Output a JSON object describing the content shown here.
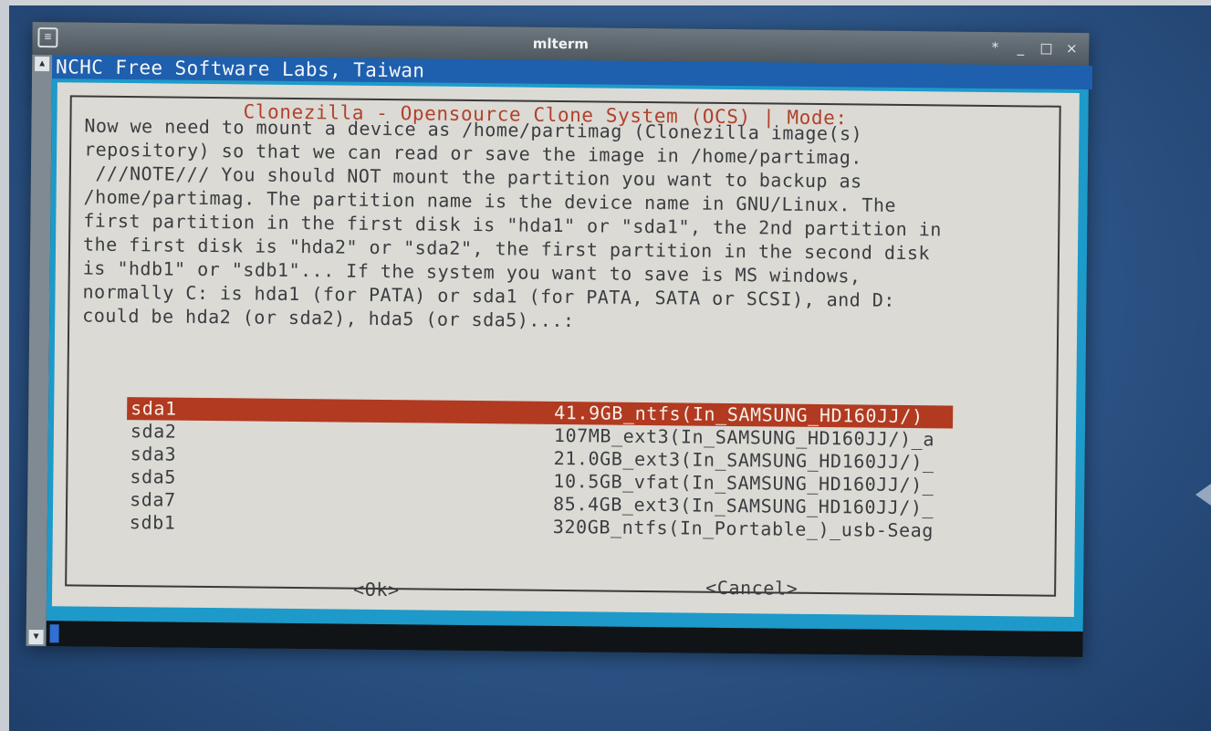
{
  "window": {
    "title": "mlterm",
    "menu_icon": "menu-icon",
    "controls": [
      "*",
      "_",
      "□",
      "×"
    ]
  },
  "scrollbar": {
    "up": "▲",
    "down": "▼"
  },
  "terminal": {
    "header": "NCHC Free Software Labs, Taiwan"
  },
  "dialog": {
    "title": "Clonezilla - Opensource Clone System (OCS) | Mode:",
    "description": "Now we need to mount a device as /home/partimag (Clonezilla image(s)\nrepository) so that we can read or save the image in /home/partimag.\n ///NOTE/// You should NOT mount the partition you want to backup as\n/home/partimag. The partition name is the device name in GNU/Linux. The\nfirst partition in the first disk is \"hda1\" or \"sda1\", the 2nd partition in\nthe first disk is \"hda2\" or \"sda2\", the first partition in the second disk\nis \"hdb1\" or \"sdb1\"... If the system you want to save is MS windows,\nnormally C: is hda1 (for PATA) or sda1 (for PATA, SATA or SCSI), and D:\ncould be hda2 (or sda2), hda5 (or sda5)...:",
    "items": [
      {
        "device": "sda1",
        "info": "41.9GB_ntfs(In_SAMSUNG_HD160JJ/)"
      },
      {
        "device": "sda2",
        "info": "107MB_ext3(In_SAMSUNG_HD160JJ/)_a"
      },
      {
        "device": "sda3",
        "info": "21.0GB_ext3(In_SAMSUNG_HD160JJ/)_"
      },
      {
        "device": "sda5",
        "info": "10.5GB_vfat(In_SAMSUNG_HD160JJ/)_"
      },
      {
        "device": "sda7",
        "info": "85.4GB_ext3(In_SAMSUNG_HD160JJ/)_"
      },
      {
        "device": "sdb1",
        "info": "320GB_ntfs(In_Portable_)_usb-Seag"
      }
    ],
    "selected_index": 0,
    "ok_label": "<Ok>",
    "cancel_label": "<Cancel>"
  }
}
